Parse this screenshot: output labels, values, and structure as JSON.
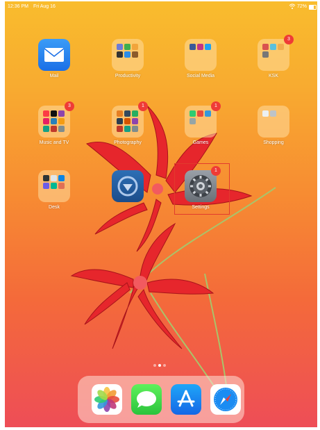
{
  "status_bar": {
    "time": "12:36 PM",
    "date": "Fri Aug 16",
    "battery": "72%",
    "wifi_icon": "wifi-icon",
    "battery_icon": "battery-icon"
  },
  "home": {
    "apps": [
      {
        "label": "Mail",
        "kind": "app",
        "icon": "mail-icon"
      },
      {
        "label": "Productivity",
        "kind": "folder"
      },
      {
        "label": "Social Media",
        "kind": "folder"
      },
      {
        "label": "KSK",
        "kind": "folder",
        "badge": "3"
      },
      {
        "label": "Music and TV",
        "kind": "folder",
        "badge": "3"
      },
      {
        "label": "Photography",
        "kind": "folder",
        "badge": "1"
      },
      {
        "label": "Games",
        "kind": "folder",
        "badge": "1"
      },
      {
        "label": "Shopping",
        "kind": "folder"
      },
      {
        "label": "Desk",
        "kind": "folder"
      },
      {
        "label": "",
        "kind": "app",
        "icon": "blurred-app-icon"
      },
      {
        "label": "Settings",
        "kind": "app",
        "icon": "gear-icon",
        "badge": "1"
      }
    ]
  },
  "page_dots": {
    "count": 3,
    "active": 1
  },
  "dock": {
    "apps": [
      {
        "icon": "photos-icon"
      },
      {
        "icon": "messages-icon"
      },
      {
        "icon": "app-store-icon"
      },
      {
        "icon": "safari-icon"
      }
    ]
  },
  "colors": {
    "wallpaper_top": "#f9bc2d",
    "wallpaper_bottom": "#ee4d57",
    "badge": "#ef3b36",
    "highlight": "#e23b2e"
  }
}
